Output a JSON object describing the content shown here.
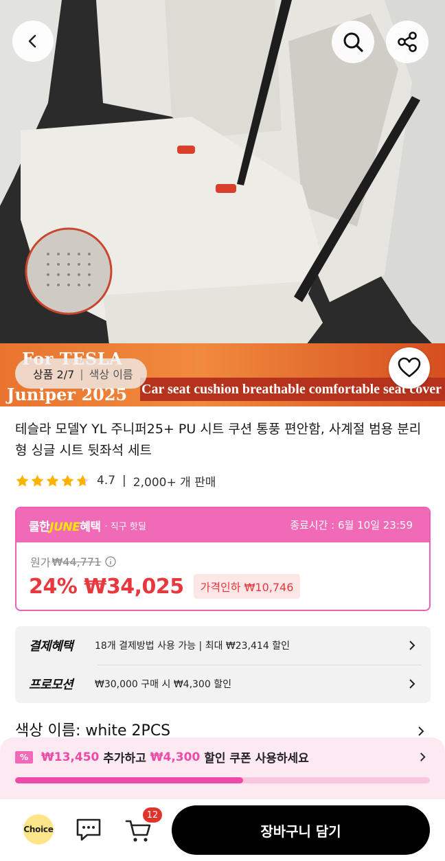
{
  "gallery": {
    "banner_line1": "For TESLA",
    "banner_line2": "Juniper 2025",
    "banner_caption": "Car seat cushion breathable comfortable seat cover",
    "counter": "상품 2/7",
    "option_label": "색상 이름",
    "icons": {
      "back": "chevron-left-icon",
      "search": "search-icon",
      "share": "share-icon",
      "wishlist": "heart-icon"
    }
  },
  "product": {
    "title": "테슬라 모델Y YL 주니퍼25+ PU 시트 쿠션 통풍 편안함, 사계절 범용 분리형 싱글 시트 뒷좌석 세트",
    "rating": "4.7",
    "stars": 4.7,
    "sold": "2,000+ 개 판매"
  },
  "promo": {
    "logo_prefix": "쿨한",
    "logo_june": "JUNE",
    "logo_suffix": "혜택",
    "subtitle": "· 직구 핫딜",
    "end_time": "종료시간 :  6월 10일 23:59",
    "original_label": "원가",
    "original_price": "₩44,771",
    "sale_price": "24% ₩34,025",
    "price_drop": "가격인하 ₩10,746",
    "accent_color": "#f06ab8",
    "price_color": "#e8383d"
  },
  "benefits": [
    {
      "label": "결제혜택",
      "text": "18개 결제방법 사용 가능 | 최대 ₩23,414 할인"
    },
    {
      "label": "프로모션",
      "text": "₩30,000 구매 시 ₩4,300 할인"
    }
  ],
  "color_option": "색상 이름: white 2PCS",
  "coupon": {
    "icon_text": "%",
    "amount_needed": "₩13,450",
    "text_mid": " 추가하고 ",
    "discount": "₩4,300",
    "text_end": " 할인 쿠폰 사용하세요",
    "progress": 0.55
  },
  "bottom_bar": {
    "choice": "Choice",
    "cart_count": "12",
    "add_to_cart": "장바구니 담기"
  }
}
